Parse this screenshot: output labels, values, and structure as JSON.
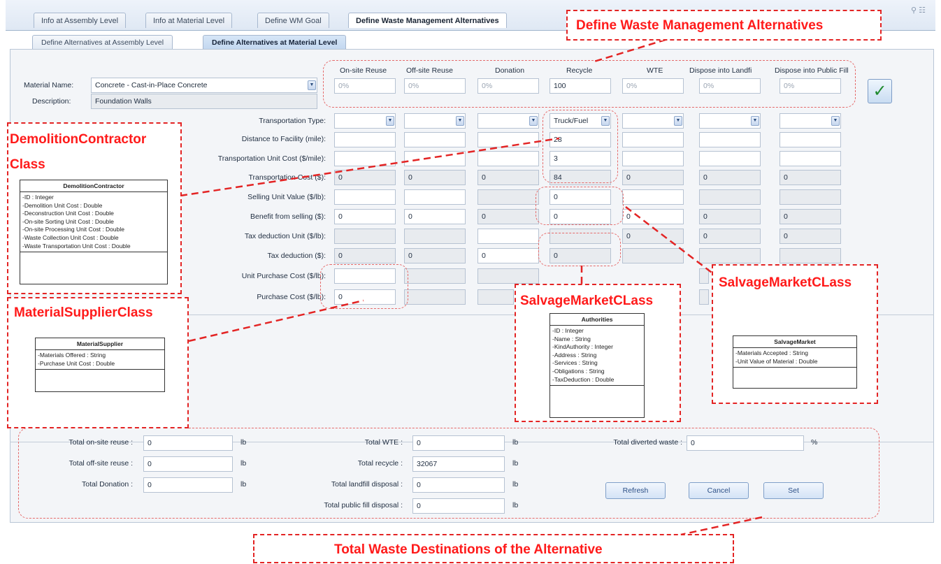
{
  "tabs": [
    "Info at Assembly Level",
    "Info at Material Level",
    "Define WM Goal",
    "Define Waste Management Alternatives"
  ],
  "subtabs": [
    "Define Alternatives at Assembly Level",
    "Define Alternatives at Material Level"
  ],
  "window_controls": "⚲ ☷",
  "material": {
    "name_label": "Material Name:",
    "name_value": "Concrete - Cast-in-Place Concrete",
    "desc_label": "Description:",
    "desc_value": "Foundation Walls"
  },
  "columns": [
    "On-site Reuse",
    "Off-site Reuse",
    "Donation",
    "Recycle",
    "WTE",
    "Dispose into Landfi",
    "Dispose into Public Fill"
  ],
  "percent_values": [
    "0%",
    "0%",
    "0%",
    "100",
    "0%",
    "0%",
    "0%"
  ],
  "row_labels": [
    "Transportation Type:",
    "Distance to Facility (mile):",
    "Transportation Unit Cost ($/mile):",
    "Transportation Cost ($):",
    "Selling Unit Value ($/lb):",
    "Benefit from selling ($):",
    "Tax deduction Unit ($/lb):",
    "Tax deduction ($):",
    "Unit Purchase Cost ($/lb):",
    "Purchase Cost ($/lb):"
  ],
  "cells": {
    "transport_type": [
      "",
      "",
      "",
      "Truck/Fuel",
      "",
      "",
      ""
    ],
    "distance": [
      "",
      "",
      "",
      "28",
      "",
      "",
      ""
    ],
    "unit_cost": [
      "",
      "",
      "",
      "3",
      "",
      "",
      ""
    ],
    "transport_cost": [
      "0",
      "0",
      "0",
      "84",
      "0",
      "0",
      "0"
    ],
    "selling_unit": [
      "",
      "",
      "",
      "0",
      "",
      "",
      ""
    ],
    "benefit": [
      "0",
      "0",
      "0",
      "0",
      "0",
      "0",
      "0"
    ],
    "tax_unit": [
      "",
      "",
      "",
      "",
      "0",
      "0",
      "0"
    ],
    "tax_deduction": [
      "0",
      "0",
      "0",
      "0",
      "",
      "",
      ""
    ],
    "unit_purchase": [
      "",
      "",
      "",
      "",
      "",
      "",
      ""
    ],
    "purchase_cost": [
      "0",
      "",
      "",
      "",
      "",
      "",
      ""
    ]
  },
  "totals": {
    "onsite_label": "Total on-site reuse :",
    "onsite_value": "0",
    "offsite_label": "Total off-site reuse :",
    "offsite_value": "0",
    "donation_label": "Total Donation :",
    "donation_value": "0",
    "wte_label": "Total WTE :",
    "wte_value": "0",
    "recycle_label": "Total recycle :",
    "recycle_value": "32067",
    "landfill_label": "Total landfill disposal :",
    "landfill_value": "0",
    "publicfill_label": "Total public fill disposal :",
    "publicfill_value": "0",
    "diverted_label": "Total diverted waste :",
    "diverted_value": "0",
    "unit_lb": "lb",
    "unit_pct": "%"
  },
  "buttons": {
    "refresh": "Refresh",
    "cancel": "Cancel",
    "set": "Set",
    "check": "✓"
  },
  "callouts": {
    "define_alt": "Define Waste Management Alternatives",
    "demolition": "DemolitionContractor",
    "demolition2": "Class",
    "material_supplier": "MaterialSupplierClass",
    "salvage_mid": "SalvageMarketCLass",
    "salvage_right": "SalvageMarketCLass",
    "total_dest": "Total Waste Destinations of the Alternative"
  },
  "uml": {
    "demolition": {
      "name": "DemolitionContractor",
      "attrs": [
        "-ID : Integer",
        "-Demolition Unit Cost : Double",
        "-Deconstruction Unit Cost : Double",
        "-On-site Sorting Unit Cost : Double",
        "-On-site Processing Unit Cost : Double",
        "-Waste Collection Unit Cost : Double",
        "-Waste Transportation Unit Cost : Double"
      ]
    },
    "supplier": {
      "name": "MaterialSupplier",
      "attrs": [
        "-Materials Offered : String",
        "-Purchase Unit Cost : Double"
      ]
    },
    "authorities": {
      "name": "Authorities",
      "attrs": [
        "-ID : Integer",
        "-Name : String",
        "-KindAuthority : Integer",
        "-Address : String",
        "-Services : String",
        "-Obligations : String",
        "-TaxDeduction : Double"
      ]
    },
    "salvage": {
      "name": "SalvageMarket",
      "attrs": [
        "-Materials Accepted : String",
        "-Unit Value of Material : Double"
      ]
    }
  },
  "colors": {
    "callout_red": "#ff1a1a",
    "check_green": "#1f8a2e",
    "panel_bg": "#f3f5f8"
  }
}
